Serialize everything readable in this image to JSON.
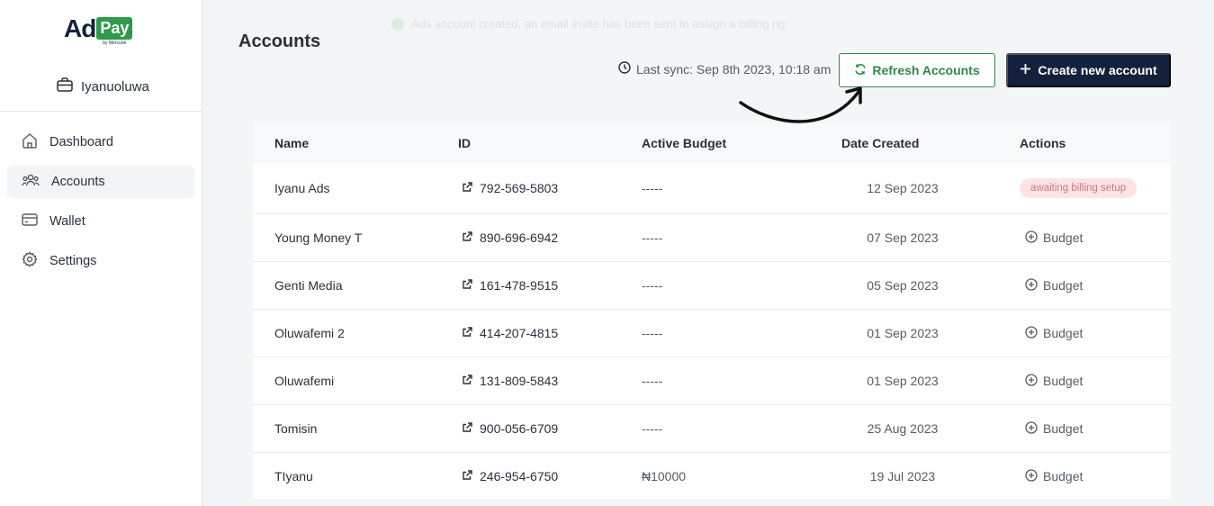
{
  "brand": {
    "logo_ad": "Ad",
    "logo_pay": "Pay",
    "logo_by": "by Mercurie",
    "green": "#2f9a4a",
    "navy": "#14213d"
  },
  "user": {
    "name": "Iyanuoluwa",
    "icon": "briefcase-icon"
  },
  "nav": {
    "items": [
      {
        "label": "Dashboard",
        "icon": "home-icon",
        "active": false
      },
      {
        "label": "Accounts",
        "icon": "users-icon",
        "active": true
      },
      {
        "label": "Wallet",
        "icon": "card-icon",
        "active": false
      },
      {
        "label": "Settings",
        "icon": "gear-icon",
        "active": false
      }
    ]
  },
  "header": {
    "title": "Accounts",
    "toast": "Ads account created, an email invite has been sent to assign a billing ng",
    "last_sync": "Last sync: Sep 8th 2023, 10:18 am",
    "refresh_label": "Refresh Accounts",
    "create_label": "Create new account"
  },
  "table": {
    "columns": [
      "Name",
      "ID",
      "Active Budget",
      "Date Created",
      "Actions"
    ],
    "rows": [
      {
        "name": "Iyanu Ads",
        "id": "792-569-5803",
        "budget": "-----",
        "date": "12 Sep 2023",
        "action": "awaiting billing setup",
        "status": true
      },
      {
        "name": "Young Money T",
        "id": "890-696-6942",
        "budget": "-----",
        "date": "07 Sep 2023",
        "action": "Budget",
        "status": false
      },
      {
        "name": "Genti Media",
        "id": "161-478-9515",
        "budget": "-----",
        "date": "05 Sep 2023",
        "action": "Budget",
        "status": false
      },
      {
        "name": "Oluwafemi 2",
        "id": "414-207-4815",
        "budget": "-----",
        "date": "01 Sep 2023",
        "action": "Budget",
        "status": false
      },
      {
        "name": "Oluwafemi",
        "id": "131-809-5843",
        "budget": "-----",
        "date": "01 Sep 2023",
        "action": "Budget",
        "status": false
      },
      {
        "name": "Tomisin",
        "id": "900-056-6709",
        "budget": "-----",
        "date": "25 Aug 2023",
        "action": "Budget",
        "status": false
      },
      {
        "name": "TIyanu",
        "id": "246-954-6750",
        "budget": "₦10000",
        "date": "19 Jul 2023",
        "action": "Budget",
        "status": false
      }
    ]
  }
}
